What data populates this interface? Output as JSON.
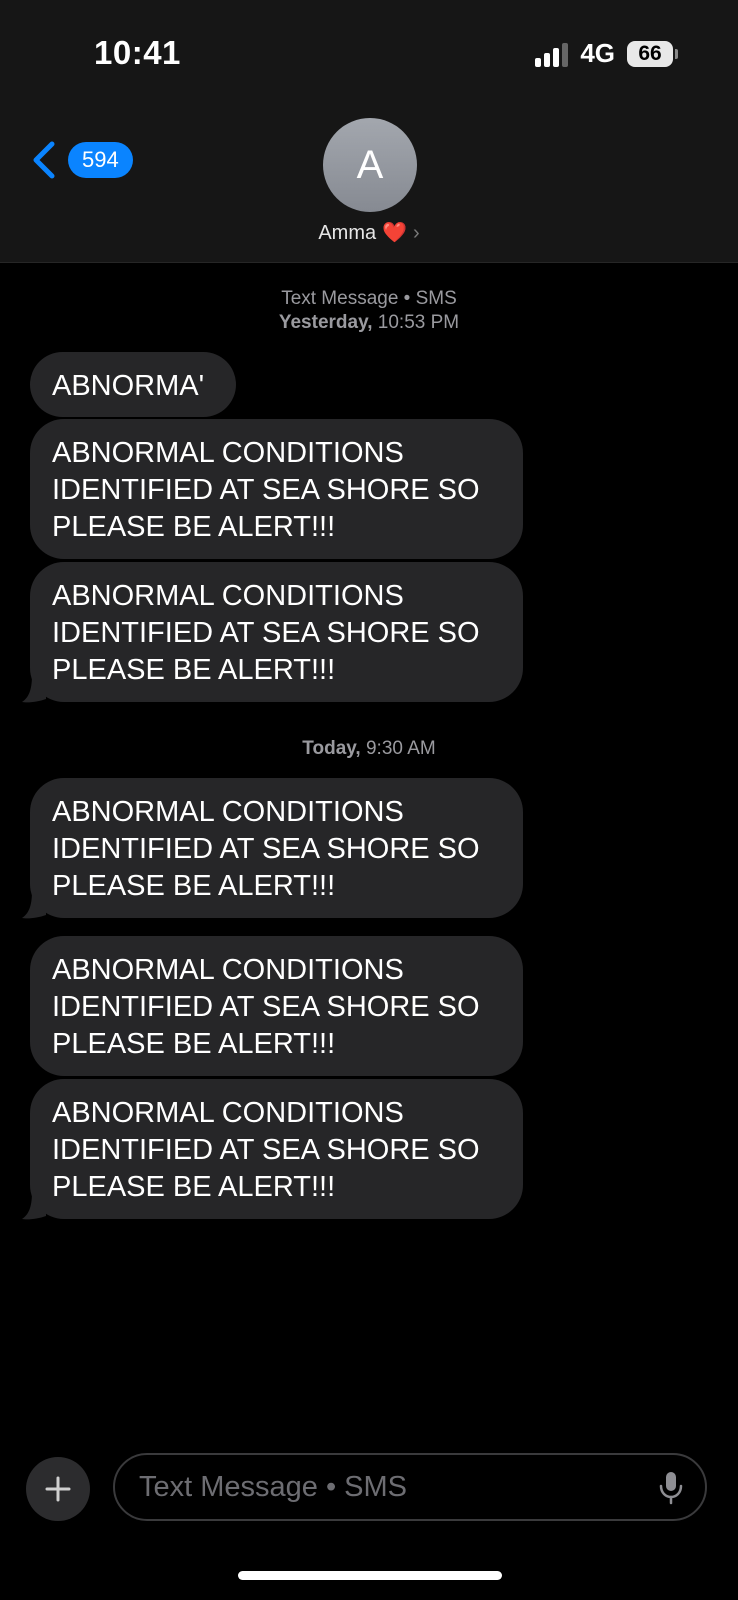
{
  "status_bar": {
    "time": "10:41",
    "network": "4G",
    "battery": "66"
  },
  "nav": {
    "back_count": "594",
    "avatar_initial": "A",
    "contact_name": "Amma",
    "contact_emoji": "❤️",
    "chevron": "›"
  },
  "thread": {
    "header1": {
      "line1": "Text Message • SMS",
      "line2_day": "Yesterday,",
      "line2_time": "10:53 PM"
    },
    "header2": {
      "day": "Today,",
      "time": "9:30 AM"
    },
    "messages": [
      "ABNORMA'",
      "ABNORMAL CONDITIONS IDENTIFIED AT SEA SHORE SO PLEASE BE ALERT!!!",
      "ABNORMAL CONDITIONS IDENTIFIED AT SEA SHORE SO PLEASE BE ALERT!!!",
      "ABNORMAL CONDITIONS IDENTIFIED AT SEA SHORE SO PLEASE BE ALERT!!!",
      "ABNORMAL CONDITIONS IDENTIFIED AT SEA SHORE SO PLEASE BE ALERT!!!",
      "ABNORMAL CONDITIONS IDENTIFIED AT SEA SHORE SO PLEASE BE ALERT!!!"
    ]
  },
  "composer": {
    "placeholder": "Text Message • SMS",
    "plus_icon": "plus-icon",
    "mic_icon": "microphone-icon"
  },
  "colors": {
    "accent": "#0a84ff",
    "bubble": "#262628",
    "background": "#000000",
    "header": "#161616"
  }
}
